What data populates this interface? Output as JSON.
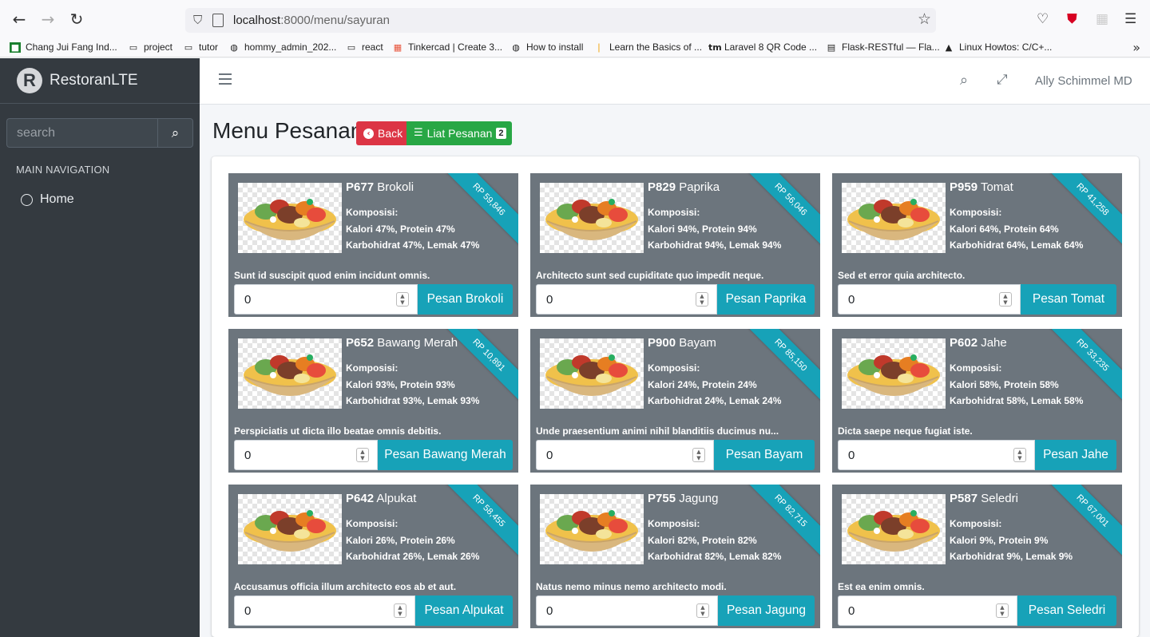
{
  "browser": {
    "url_host": "localhost",
    "url_rest": ":8000/menu/sayuran",
    "bookmarks": [
      "Chang Jui Fang Ind...",
      "project",
      "tutor",
      "hommy_admin_202...",
      "react",
      "Tinkercad | Create 3...",
      "How to install",
      "Learn the Basics of ...",
      "Laravel 8 QR Code ...",
      "Flask-RESTful — Fla...",
      "Linux Howtos: C/C+..."
    ]
  },
  "sidebar": {
    "brand_bold": "Restoran",
    "brand_light": "LTE",
    "search_placeholder": "search",
    "nav_header": "MAIN NAVIGATION",
    "home_label": "Home"
  },
  "topbar": {
    "user_name": "Ally Schimmel MD"
  },
  "header": {
    "title": "Menu Pesanan",
    "back_label": "Back",
    "liat_label": "Liat Pesanan",
    "cart_count": "2"
  },
  "products": [
    {
      "code": "P677",
      "name": "Brokoli",
      "komposisi": "Komposisi:",
      "line1": "Kalori 47%, Protein 47%",
      "line2": "Karbohidrat 47%, Lemak 47%",
      "price": "RP 59,846",
      "desc": "Sunt id suscipit quod enim incidunt omnis.",
      "qty": "0",
      "button": "Pesan Brokoli"
    },
    {
      "code": "P829",
      "name": "Paprika",
      "komposisi": "Komposisi:",
      "line1": "Kalori 94%, Protein 94%",
      "line2": "Karbohidrat 94%, Lemak 94%",
      "price": "RP 56,046",
      "desc": "Architecto sunt sed cupiditate quo impedit neque.",
      "qty": "0",
      "button": "Pesan Paprika"
    },
    {
      "code": "P959",
      "name": "Tomat",
      "komposisi": "Komposisi:",
      "line1": "Kalori 64%, Protein 64%",
      "line2": "Karbohidrat 64%, Lemak 64%",
      "price": "RP 41,258",
      "desc": "Sed et error quia architecto.",
      "qty": "0",
      "button": "Pesan Tomat"
    },
    {
      "code": "P652",
      "name": "Bawang Merah",
      "komposisi": "Komposisi:",
      "line1": "Kalori 93%, Protein 93%",
      "line2": "Karbohidrat 93%, Lemak 93%",
      "price": "RP 10,891",
      "desc": "Perspiciatis ut dicta illo beatae omnis debitis.",
      "qty": "0",
      "button": "Pesan Bawang Merah"
    },
    {
      "code": "P900",
      "name": "Bayam",
      "komposisi": "Komposisi:",
      "line1": "Kalori 24%, Protein 24%",
      "line2": "Karbohidrat 24%, Lemak 24%",
      "price": "RP 85,150",
      "desc": "Unde praesentium animi nihil blanditiis ducimus nu...",
      "qty": "0",
      "button": "Pesan Bayam"
    },
    {
      "code": "P602",
      "name": "Jahe",
      "komposisi": "Komposisi:",
      "line1": "Kalori 58%, Protein 58%",
      "line2": "Karbohidrat 58%, Lemak 58%",
      "price": "RP 33,235",
      "desc": "Dicta saepe neque fugiat iste.",
      "qty": "0",
      "button": "Pesan Jahe"
    },
    {
      "code": "P642",
      "name": "Alpukat",
      "komposisi": "Komposisi:",
      "line1": "Kalori 26%, Protein 26%",
      "line2": "Karbohidrat 26%, Lemak 26%",
      "price": "RP 58,455",
      "desc": "Accusamus officia illum architecto eos ab et aut.",
      "qty": "0",
      "button": "Pesan Alpukat"
    },
    {
      "code": "P755",
      "name": "Jagung",
      "komposisi": "Komposisi:",
      "line1": "Kalori 82%, Protein 82%",
      "line2": "Karbohidrat 82%, Lemak 82%",
      "price": "RP 82,715",
      "desc": "Natus nemo minus nemo architecto modi.",
      "qty": "0",
      "button": "Pesan Jagung"
    },
    {
      "code": "P587",
      "name": "Seledri",
      "komposisi": "Komposisi:",
      "line1": "Kalori 9%, Protein 9%",
      "line2": "Karbohidrat 9%, Lemak 9%",
      "price": "RP 67,001",
      "desc": "Est ea enim omnis.",
      "qty": "0",
      "button": "Pesan Seledri"
    }
  ],
  "colors": {
    "sidebar": "#343a40",
    "card": "#6c757d",
    "info": "#17a2b8",
    "danger": "#dc3545",
    "success": "#28a745"
  }
}
